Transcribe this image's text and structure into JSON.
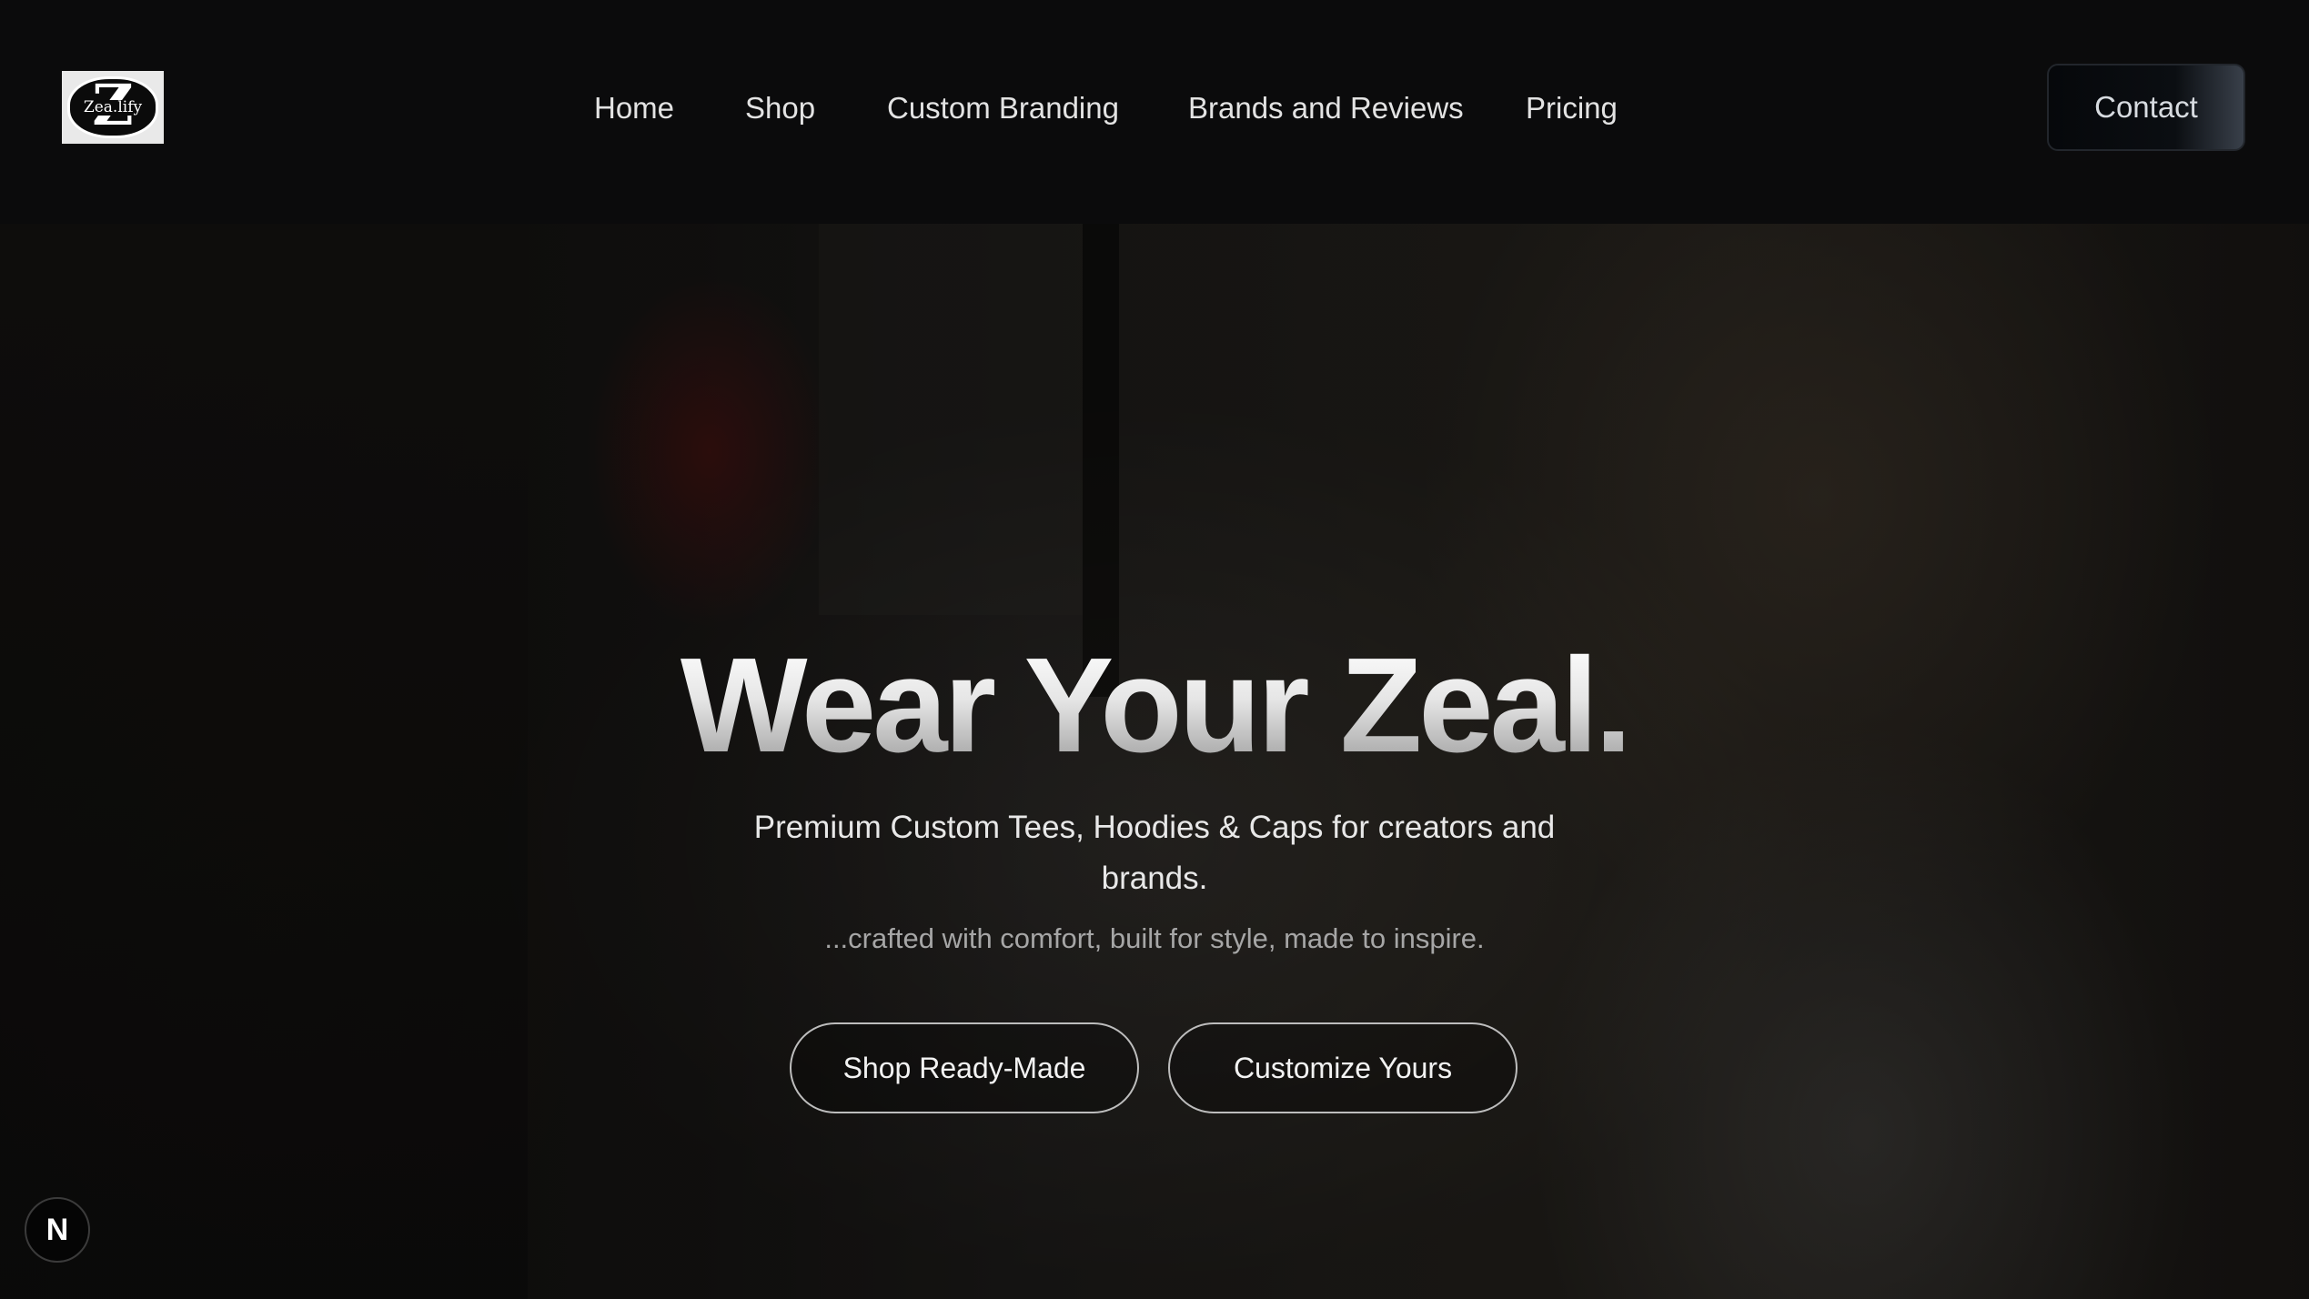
{
  "header": {
    "logo_text": "Zea.lify",
    "nav": [
      "Home",
      "Shop",
      "Custom Branding",
      "Brands and Reviews",
      "Pricing"
    ],
    "contact_label": "Contact"
  },
  "hero": {
    "title": "Wear Your Zeal.",
    "subtitle": "Premium Custom Tees, Hoodies & Caps for creators and brands.",
    "tagline": "...crafted with comfort, built for style, made to inspire.",
    "buttons": [
      "Shop Ready-Made",
      "Customize Yours"
    ]
  },
  "badge": {
    "label": "N"
  },
  "colors": {
    "background": "#0b0b0c",
    "text": "#e3e3e3",
    "muted": "#a6a6a6"
  }
}
